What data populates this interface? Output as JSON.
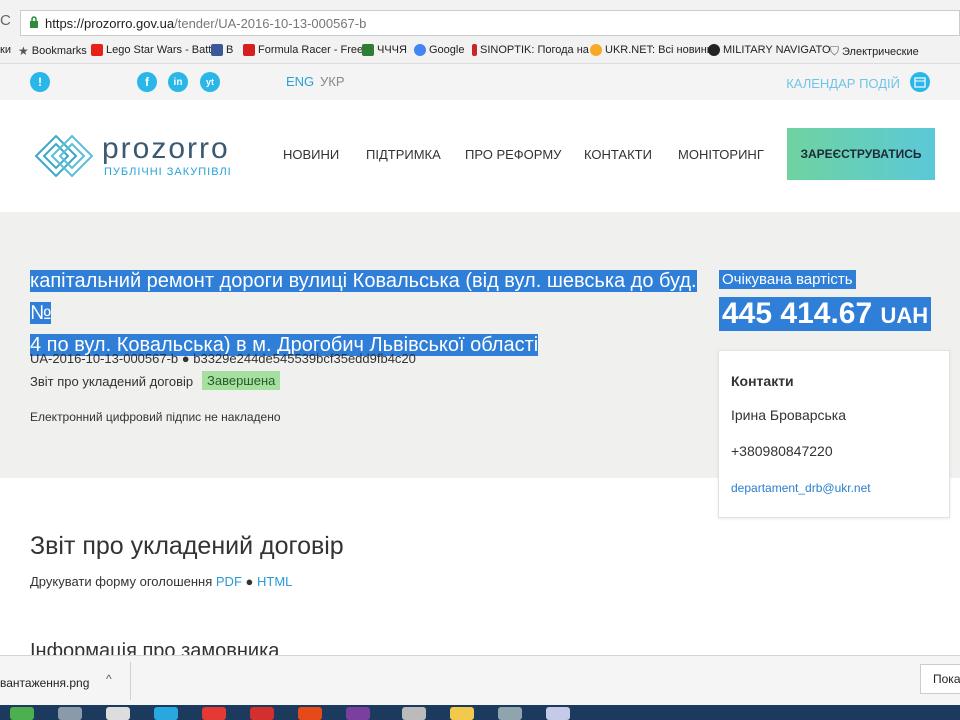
{
  "browser": {
    "reload_glyph": "C",
    "url_host": "https://prozorro.gov.ua",
    "url_path": "/tender/UA-2016-10-13-000567-b"
  },
  "bookmarks": [
    {
      "label": "ки",
      "icon": "none"
    },
    {
      "label": "Bookmarks",
      "icon": "star-icon"
    },
    {
      "label": "Lego Star Wars - Batt",
      "icon": "youtube-icon",
      "color": "#e62117"
    },
    {
      "label": "B",
      "icon": "facebook-icon",
      "color": "#3b5998"
    },
    {
      "label": "Formula Racer - Free",
      "icon": "formula-icon",
      "color": "#d61f1f"
    },
    {
      "label": "ЧЧЧЯ",
      "icon": "site-icon",
      "color": "#2e7d32"
    },
    {
      "label": "Google",
      "icon": "google-icon",
      "color": "#4285f4"
    },
    {
      "label": "SINOPTIK: Погода на",
      "icon": "thermometer-icon",
      "color": "#c62828"
    },
    {
      "label": "UKR.NET: Всі новини",
      "icon": "ukrnet-icon",
      "color": "#f9a825"
    },
    {
      "label": "MILITARY NAVIGATO",
      "icon": "military-icon",
      "color": "#222222"
    },
    {
      "label": "Электрические",
      "icon": "tooth-icon",
      "color": "#555555"
    }
  ],
  "topbar": {
    "alert": "!",
    "social": [
      "f",
      "in",
      "yt"
    ],
    "lang_en": "ENG",
    "lang_uk": "УКР",
    "calendar": "КАЛЕНДАР ПОДІЙ"
  },
  "header": {
    "logo_text": "prozorro",
    "logo_sub": "ПУБЛІЧНІ ЗАКУПІВЛІ",
    "nav": [
      "НОВИНИ",
      "ПІДТРИМКА",
      "ПРО РЕФОРМУ",
      "КОНТАКТИ",
      "МОНІТОРИНГ"
    ],
    "register": "ЗАРЕЄСТРУВАТИСЬ"
  },
  "tender": {
    "title_line1": "капітальний ремонт дороги вулиці Ковальська (від вул. шевська до буд. №",
    "title_line2": "4 по вул. Ковальська) в м. Дрогобич Львівської області",
    "id_line": "UA-2016-10-13-000567-b ● b3329e244de545539bcf35edd9fb4c20",
    "report_type": "Звіт про укладений договір",
    "status": "Завершена",
    "esign": "Електронний цифровий підпис не накладено",
    "price_label": "Очікувана вартість",
    "price_value": "445 414.67",
    "price_currency": "UAH"
  },
  "contacts": {
    "heading": "Контакти",
    "name": "Ірина Броварська",
    "phone": "+380980847220",
    "email": "departament_drb@ukr.net"
  },
  "body": {
    "section_title": "Звіт про укладений договір",
    "print_prefix": "Друкувати форму оголошення",
    "pdf": "PDF",
    "sep": "●",
    "html": "HTML",
    "next_section": "Інформація про замовника"
  },
  "downloads": {
    "file": "вантаження.png",
    "show_all": "Показ"
  }
}
